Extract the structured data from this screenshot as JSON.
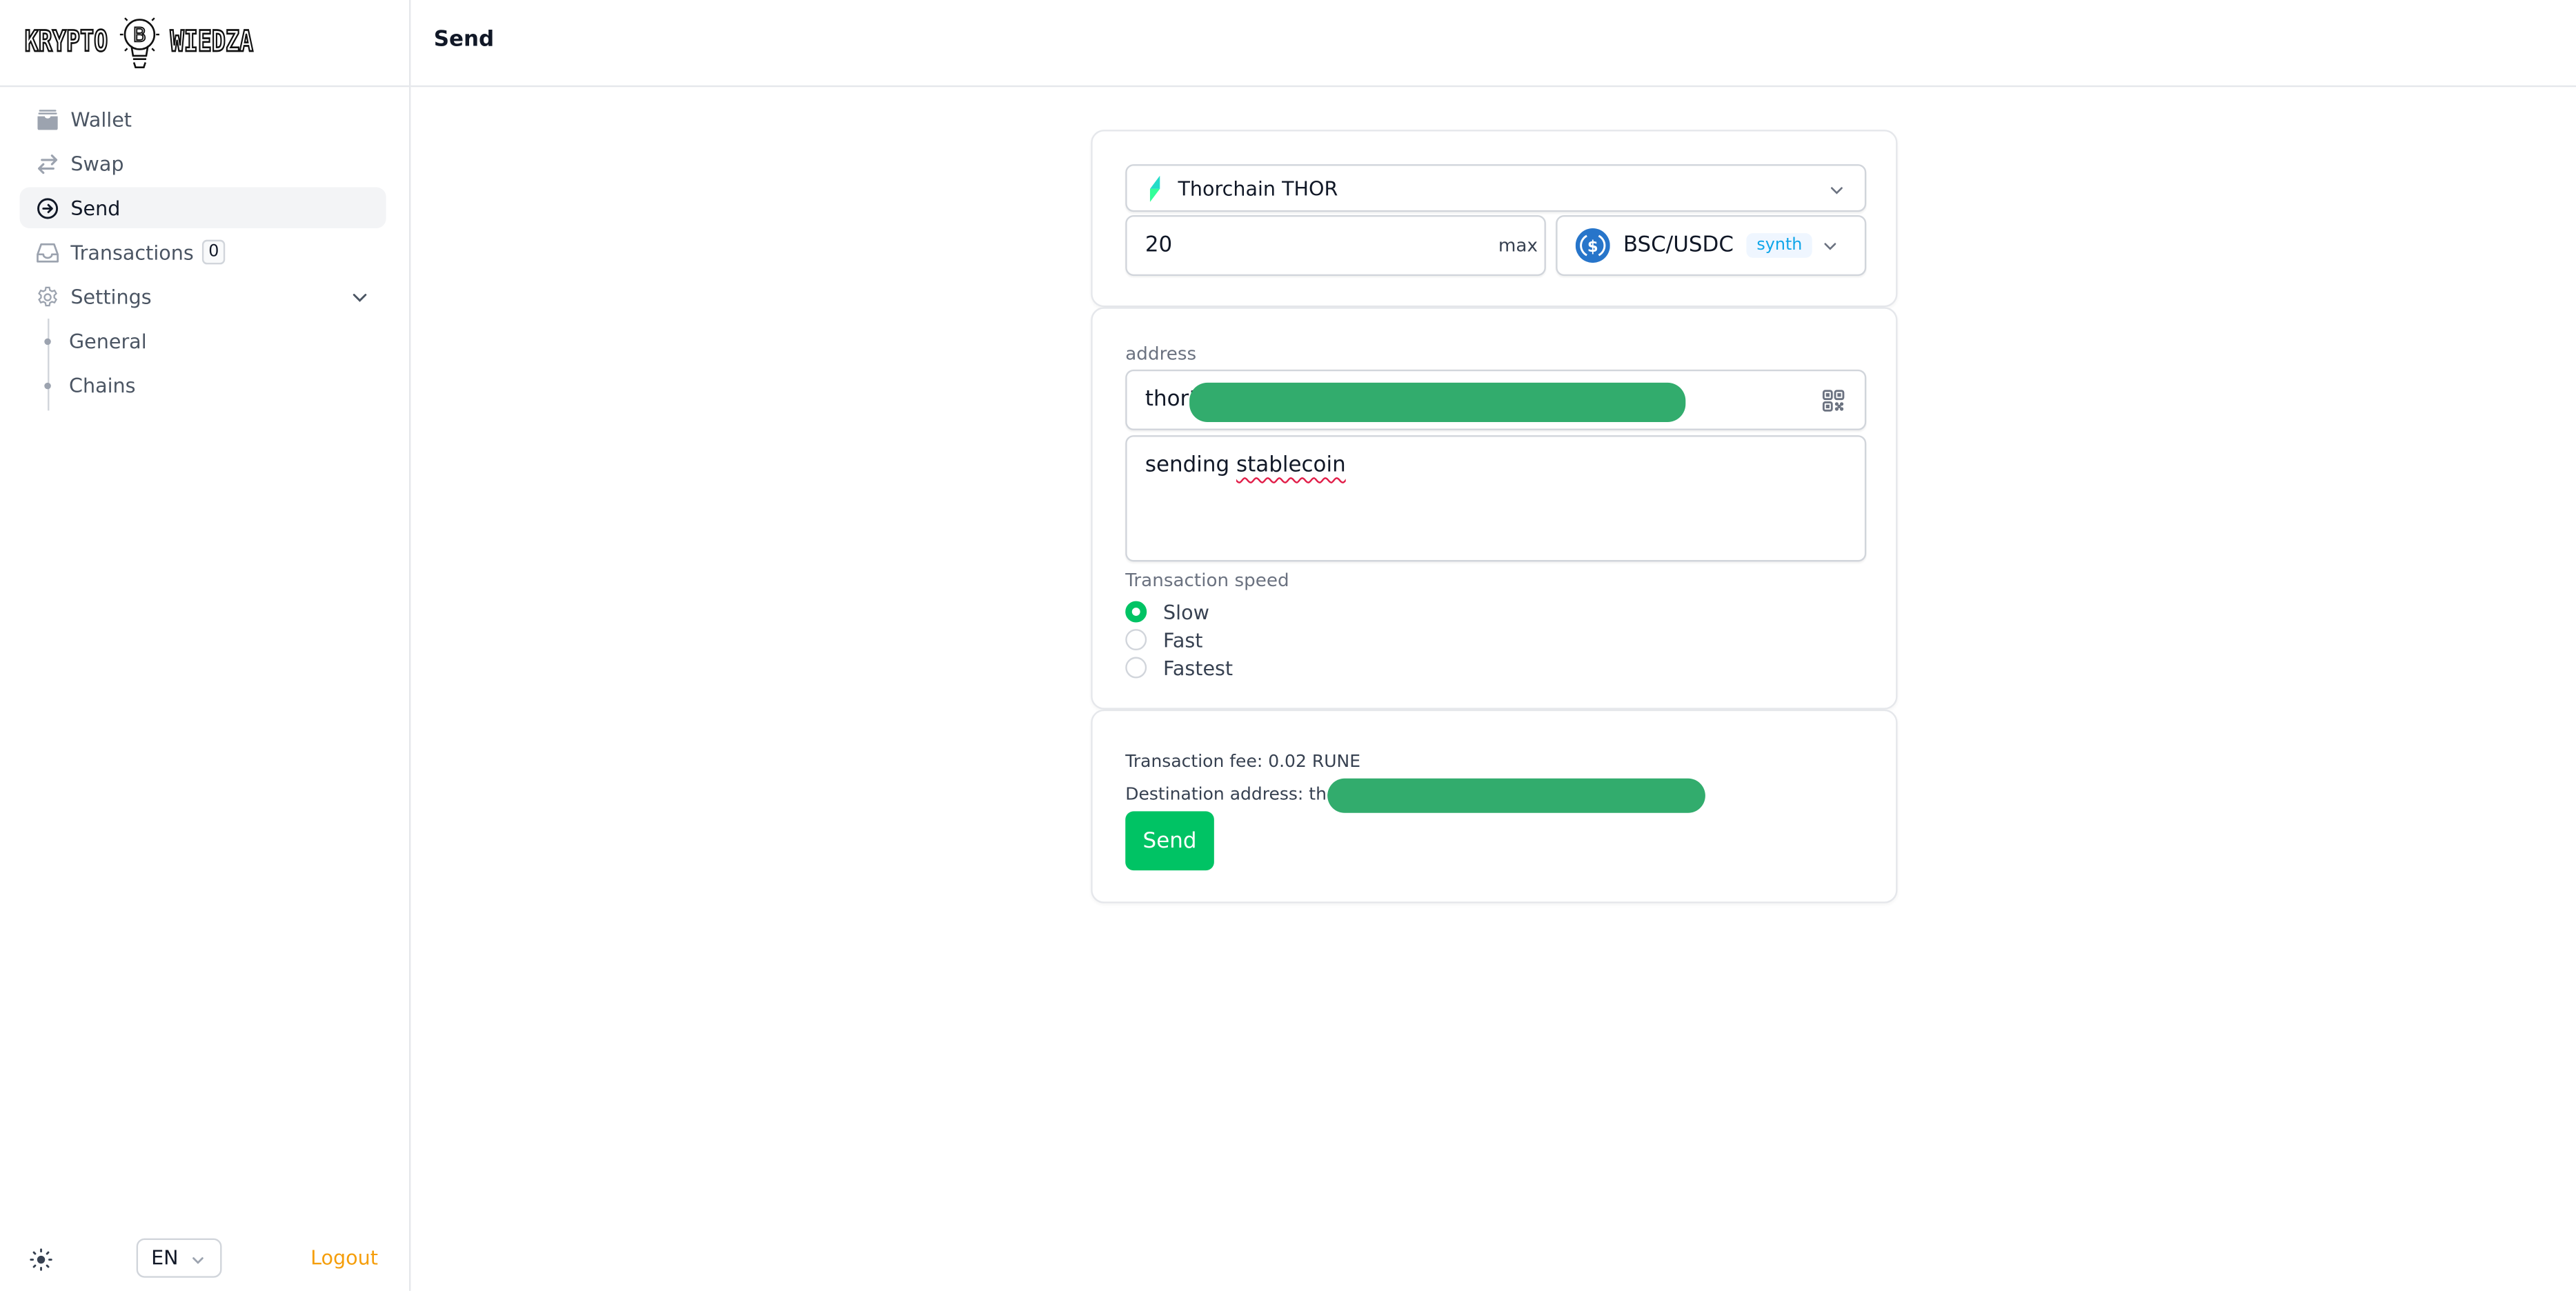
{
  "app": {
    "logo_left": "KRYPTO",
    "logo_right": "WIEDZA"
  },
  "header": {
    "title": "Send"
  },
  "sidebar": {
    "items": [
      {
        "label": "Wallet",
        "icon": "wallet-icon",
        "active": false
      },
      {
        "label": "Swap",
        "icon": "swap-arrows-icon",
        "active": false
      },
      {
        "label": "Send",
        "icon": "arrow-circle-right-icon",
        "active": true
      },
      {
        "label": "Transactions",
        "icon": "inbox-icon",
        "active": false,
        "badge": "0"
      },
      {
        "label": "Settings",
        "icon": "gear-icon",
        "active": false,
        "expanded": true
      }
    ],
    "settings_children": [
      {
        "label": "General"
      },
      {
        "label": "Chains"
      }
    ],
    "footer": {
      "theme_icon": "sun-icon",
      "language": "EN",
      "logout": "Logout"
    }
  },
  "form": {
    "chain": {
      "label": "Thorchain THOR",
      "icon": "thorchain-icon"
    },
    "amount": {
      "value": "20",
      "max_label": "max"
    },
    "asset": {
      "label": "BSC/USDC",
      "tag": "synth",
      "icon": "usdc-icon"
    },
    "address": {
      "label": "address",
      "value_prefix": "thor1",
      "redacted": true
    },
    "memo": {
      "word1": "sending ",
      "word2": "stablecoin"
    },
    "speed": {
      "label": "Transaction speed",
      "options": [
        {
          "label": "Slow",
          "checked": true
        },
        {
          "label": "Fast",
          "checked": false
        },
        {
          "label": "Fastest",
          "checked": false
        }
      ]
    },
    "summary": {
      "fee": "Transaction fee: 0.02 RUNE",
      "destination_prefix": "Destination address: thor",
      "destination_redacted": true
    },
    "send_button": "Send"
  },
  "colors": {
    "primary": "#00c364",
    "logout": "#f59e0b",
    "synth_text": "#0ea5e9",
    "redaction": "#32ac6d"
  }
}
